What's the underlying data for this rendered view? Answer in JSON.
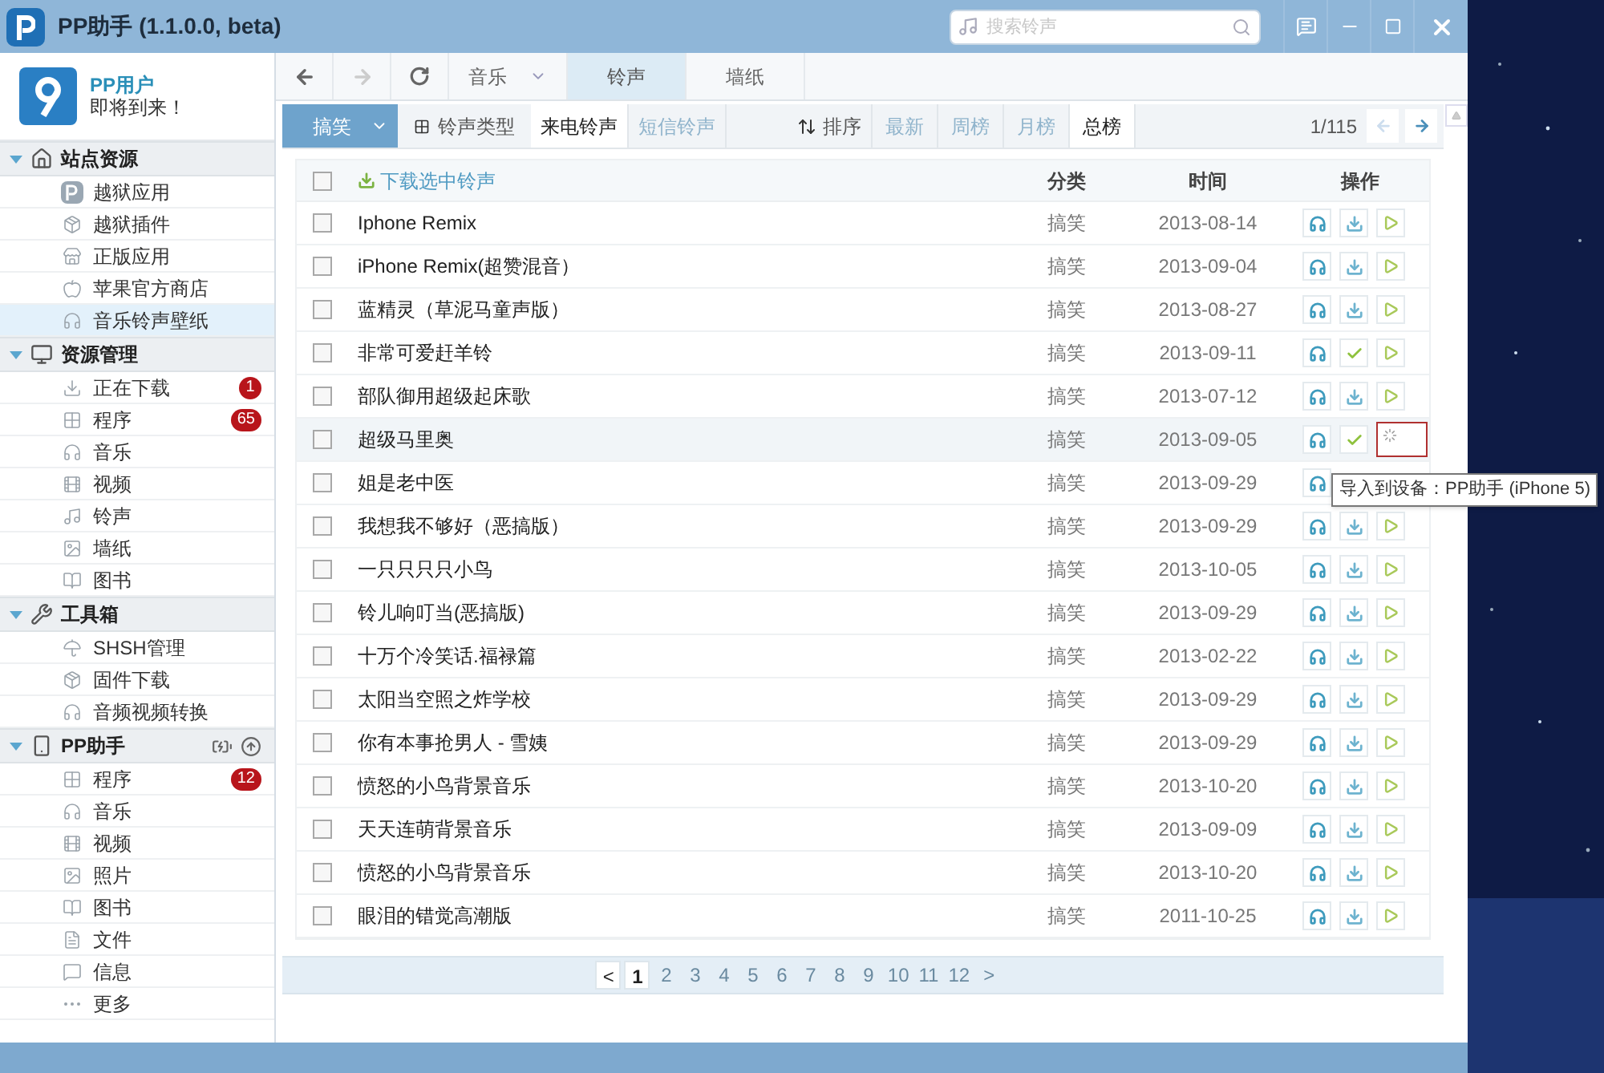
{
  "window": {
    "title": "PP助手 (1.1.0.0, beta)"
  },
  "search": {
    "placeholder": "搜索铃声"
  },
  "user": {
    "name": "PP用户",
    "subtitle": "即将到来！"
  },
  "sidebar": [
    {
      "title": "站点资源",
      "kind": "site",
      "expanded": true,
      "items": [
        {
          "label": "越狱应用",
          "selected": false
        },
        {
          "label": "越狱插件",
          "selected": false
        },
        {
          "label": "正版应用",
          "selected": false
        },
        {
          "label": "苹果官方商店",
          "selected": false
        },
        {
          "label": "音乐铃声壁纸",
          "selected": true
        }
      ]
    },
    {
      "title": "资源管理",
      "kind": "monitor",
      "expanded": true,
      "items": [
        {
          "label": "正在下载",
          "selected": false,
          "badge": "1"
        },
        {
          "label": "程序",
          "selected": false,
          "badge": "65"
        },
        {
          "label": "音乐",
          "selected": false
        },
        {
          "label": "视频",
          "selected": false
        },
        {
          "label": "铃声",
          "selected": false
        },
        {
          "label": "墙纸",
          "selected": false
        },
        {
          "label": "图书",
          "selected": false
        }
      ]
    },
    {
      "title": "工具箱",
      "kind": "tools",
      "expanded": true,
      "items": [
        {
          "label": "SHSH管理",
          "selected": false
        },
        {
          "label": "固件下载",
          "selected": false
        },
        {
          "label": "音频视频转换",
          "selected": false
        }
      ]
    },
    {
      "title": "PP助手",
      "kind": "device",
      "expanded": true,
      "items": [
        {
          "label": "程序",
          "selected": false,
          "badge": "12"
        },
        {
          "label": "音乐",
          "selected": false
        },
        {
          "label": "视频",
          "selected": false
        },
        {
          "label": "照片",
          "selected": false
        },
        {
          "label": "图书",
          "selected": false
        },
        {
          "label": "文件",
          "selected": false
        },
        {
          "label": "信息",
          "selected": false
        },
        {
          "label": "更多",
          "selected": false
        }
      ]
    }
  ],
  "nav_tabs": [
    {
      "label": "音乐",
      "selected": false,
      "dropdown": true
    },
    {
      "label": "铃声",
      "selected": true,
      "dropdown": false
    },
    {
      "label": "墙纸",
      "selected": false,
      "dropdown": false
    }
  ],
  "category_button": "搞笑",
  "type_label": "铃声类型",
  "type_tabs": [
    {
      "label": "来电铃声",
      "selected": true
    },
    {
      "label": "短信铃声",
      "selected": false
    }
  ],
  "sort_label": "排序",
  "sort_tabs": [
    {
      "label": "最新",
      "selected": false
    },
    {
      "label": "周榜",
      "selected": false
    },
    {
      "label": "月榜",
      "selected": false
    },
    {
      "label": "总榜",
      "selected": true
    }
  ],
  "page_indicator": "1/115",
  "table": {
    "all_checked": false,
    "download_selected": "下载选中铃声",
    "columns": [
      "分类",
      "时间",
      "操作"
    ],
    "rows": [
      {
        "checked": false,
        "name": "Iphone Remix",
        "category": "搞笑",
        "time": "2013-08-14",
        "downloaded": false,
        "importing": false,
        "hovered": false
      },
      {
        "checked": false,
        "name": "iPhone Remix(超赞混音）",
        "category": "搞笑",
        "time": "2013-09-04",
        "downloaded": false,
        "importing": false,
        "hovered": false
      },
      {
        "checked": false,
        "name": "蓝精灵（草泥马童声版）",
        "category": "搞笑",
        "time": "2013-08-27",
        "downloaded": false,
        "importing": false,
        "hovered": false
      },
      {
        "checked": false,
        "name": "非常可爱赶羊铃",
        "category": "搞笑",
        "time": "2013-09-11",
        "downloaded": true,
        "importing": false,
        "hovered": false
      },
      {
        "checked": false,
        "name": "部队御用超级起床歌",
        "category": "搞笑",
        "time": "2013-07-12",
        "downloaded": false,
        "importing": false,
        "hovered": false
      },
      {
        "checked": false,
        "name": "超级马里奥",
        "category": "搞笑",
        "time": "2013-09-05",
        "downloaded": true,
        "importing": true,
        "hovered": true
      },
      {
        "checked": false,
        "name": "姐是老中医",
        "category": "搞笑",
        "time": "2013-09-29",
        "hovered": false
      },
      {
        "checked": false,
        "name": "我想我不够好（恶搞版）",
        "category": "搞笑",
        "time": "2013-09-29",
        "downloaded": false,
        "importing": false,
        "hovered": false
      },
      {
        "checked": false,
        "name": "一只只只只小鸟",
        "category": "搞笑",
        "time": "2013-10-05",
        "downloaded": false,
        "importing": false,
        "hovered": false
      },
      {
        "checked": false,
        "name": "铃儿响叮当(恶搞版)",
        "category": "搞笑",
        "time": "2013-09-29",
        "downloaded": false,
        "importing": false,
        "hovered": false
      },
      {
        "checked": false,
        "name": "十万个冷笑话.福禄篇",
        "category": "搞笑",
        "time": "2013-02-22",
        "downloaded": false,
        "importing": false,
        "hovered": false
      },
      {
        "checked": false,
        "name": "太阳当空照之炸学校",
        "category": "搞笑",
        "time": "2013-09-29",
        "downloaded": false,
        "importing": false,
        "hovered": false
      },
      {
        "checked": false,
        "name": "你有本事抢男人 - 雪姨",
        "category": "搞笑",
        "time": "2013-09-29",
        "downloaded": false,
        "importing": false,
        "hovered": false
      },
      {
        "checked": false,
        "name": "愤怒的小鸟背景音乐",
        "category": "搞笑",
        "time": "2013-10-20",
        "downloaded": false,
        "importing": false,
        "hovered": false
      },
      {
        "checked": false,
        "name": "天天连萌背景音乐",
        "category": "搞笑",
        "time": "2013-09-09",
        "downloaded": false,
        "importing": false,
        "hovered": false
      },
      {
        "checked": false,
        "name": "愤怒的小鸟背景音乐",
        "category": "搞笑",
        "time": "2013-10-20",
        "downloaded": false,
        "importing": false,
        "hovered": false
      },
      {
        "checked": false,
        "name": "眼泪的错觉高潮版",
        "category": "搞笑",
        "time": "2011-10-25",
        "downloaded": false,
        "importing": false,
        "hovered": false
      }
    ]
  },
  "tooltip": "导入到设备：PP助手 (iPhone 5)",
  "pagination": [
    {
      "label": "<",
      "selected": false
    },
    {
      "label": "1",
      "selected": true
    },
    {
      "label": "2",
      "selected": false
    },
    {
      "label": "3",
      "selected": false
    },
    {
      "label": "4",
      "selected": false
    },
    {
      "label": "5",
      "selected": false
    },
    {
      "label": "6",
      "selected": false
    },
    {
      "label": "7",
      "selected": false
    },
    {
      "label": "8",
      "selected": false
    },
    {
      "label": "9",
      "selected": false
    },
    {
      "label": "10",
      "selected": false
    },
    {
      "label": "11",
      "selected": false
    },
    {
      "label": "12",
      "selected": false
    },
    {
      "label": ">",
      "selected": false
    }
  ]
}
